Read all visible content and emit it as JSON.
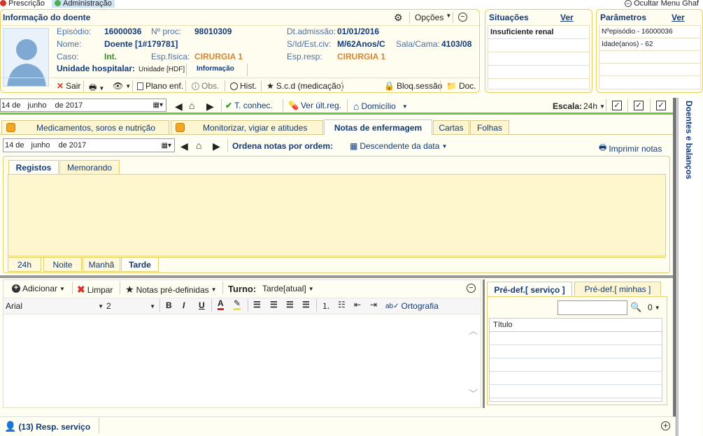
{
  "topbar": {
    "prescricao": "Prescrição",
    "administracao": "Administração",
    "hide_menu": "Ocultar Menu Ghaf"
  },
  "patient": {
    "title": "Informação do doente",
    "options": "Opções",
    "episodio_lbl": "Episódio:",
    "episodio": "16000036",
    "nproc_lbl": "Nº proc:",
    "nproc": "98010309",
    "dtadm_lbl": "Dt.admissão:",
    "dtadm": "01/01/2016",
    "nome_lbl": "Nome:",
    "nome": "Doente [1#179781]",
    "sid_lbl": "S/Id/Est.civ:",
    "sid": "M/62Anos/C",
    "sala_lbl": "Sala/Cama:",
    "sala": "4103/08",
    "caso_lbl": "Caso:",
    "caso": "Int.",
    "espfis_lbl": "Esp.física:",
    "espfis": "CIRURGIA 1",
    "espresp_lbl": "Esp.resp:",
    "espresp": "CIRURGIA 1",
    "unidade_lbl": "Unidade hospitalar:",
    "unidade": "Unidade [HDF]",
    "informacao": "Informação"
  },
  "patient_toolbar": {
    "sair": "Sair",
    "plano": "Plano enf.",
    "obs": "Obs.",
    "hist": "Hist.",
    "scd": "S.c.d (medicação)",
    "bloq": "Bloq.sessão",
    "doc": "Doc."
  },
  "situacoes": {
    "title": "Situações",
    "ver": "Ver",
    "items": [
      "Insuficiente renal"
    ]
  },
  "parametros": {
    "title": "Parâmetros",
    "ver": "Ver",
    "items": [
      "Nºepisódio - 16000036",
      "Idade(anos) - 62"
    ]
  },
  "datebar": {
    "day": "14 de",
    "month": "junho",
    "year": "de 2017",
    "tconhec": "T. conhec.",
    "verult": "Ver últ.reg.",
    "domicilio": "Domicílio",
    "escala_lbl": "Escala:",
    "escala": "24h"
  },
  "tabs": [
    "Medicamentos, soros e nutrição",
    "Monitorizar, vigiar e atitudes",
    "Notas de enfermagem",
    "Cartas",
    "Folhas"
  ],
  "notes": {
    "day": "14 de",
    "month": "junho",
    "year": "de 2017",
    "ordena_lbl": "Ordena notas por ordem:",
    "ordem": "Descendente da data",
    "imprimir": "Imprimir notas"
  },
  "subtabs": [
    "Registos",
    "Memorando"
  ],
  "shifts": [
    "24h",
    "Noite",
    "Manhã",
    "Tarde"
  ],
  "editor": {
    "adicionar": "Adicionar",
    "limpar": "Limpar",
    "notas_pre": "Notas pré-definidas",
    "turno_lbl": "Turno:",
    "turno": "Tarde[atual]",
    "font": "Arial",
    "size": "2",
    "ortografia": "Ortografia"
  },
  "predef": {
    "tab1": "Pré-def.[ serviço ]",
    "tab2": "Pré-def.[ minhas ]",
    "count": "0",
    "col_title": "Título"
  },
  "side_tab": "Doentes e balanços",
  "footer": {
    "resp": "(13) Resp. serviço"
  }
}
